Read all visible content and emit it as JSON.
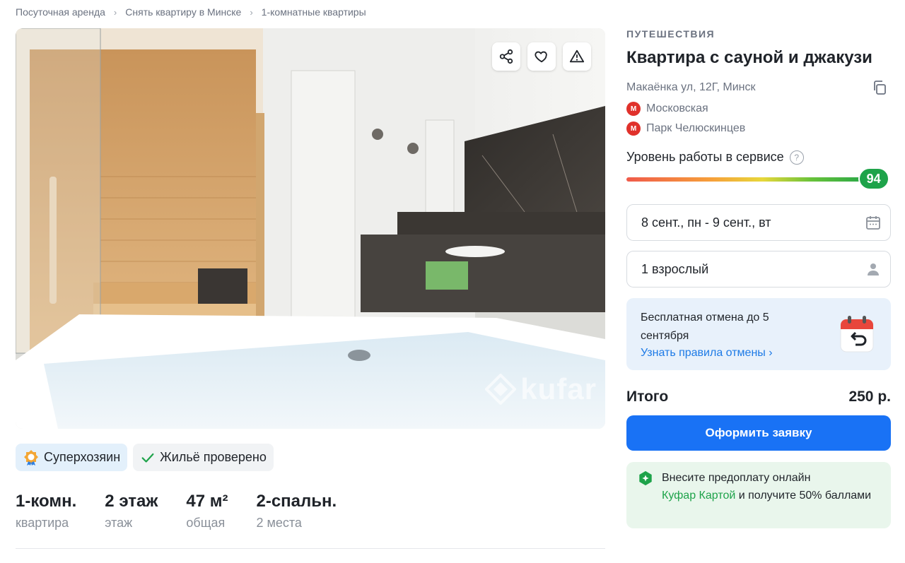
{
  "breadcrumb": [
    "Посуточная аренда",
    "Снять квартиру в Минске",
    "1-комнатные квартиры"
  ],
  "photo": {
    "actions": [
      "share-icon",
      "heart-icon",
      "warning-icon"
    ],
    "watermark": "kufar"
  },
  "badges": {
    "superhost": "Суперхозяин",
    "verified": "Жильё проверено"
  },
  "facts": [
    {
      "value": "1-комн.",
      "label": "квартира"
    },
    {
      "value": "2 этаж",
      "label": "этаж"
    },
    {
      "value": "47 м²",
      "label": "общая"
    },
    {
      "value": "2-спальн.",
      "label": "2 места"
    }
  ],
  "listing": {
    "category": "ПУТЕШЕСТВИЯ",
    "title": "Квартира с сауной и джакузи",
    "address": "Макаёнка ул, 12Г, Минск",
    "metro": [
      "Московская",
      "Парк Челюскинцев"
    ]
  },
  "service": {
    "label": "Уровень работы в сервисе",
    "help": "?",
    "score": "94",
    "fraction": 0.94
  },
  "booking": {
    "dates": "8 сент., пн - 9 сент., вт",
    "guests": "1 взрослый",
    "cancel_text": "Бесплатная отмена до 5 сентября",
    "cancel_link": "Узнать правила отмены",
    "total_label": "Итого",
    "total_value": "250 р.",
    "cta": "Оформить заявку"
  },
  "promo": {
    "text_before": "Внесите предоплату онлайн",
    "link": "Куфар Картой",
    "text_after": " и получите 50% баллами"
  },
  "colors": {
    "accent": "#1972f5",
    "score": "#1ea34a",
    "metro": "#e0312b"
  }
}
